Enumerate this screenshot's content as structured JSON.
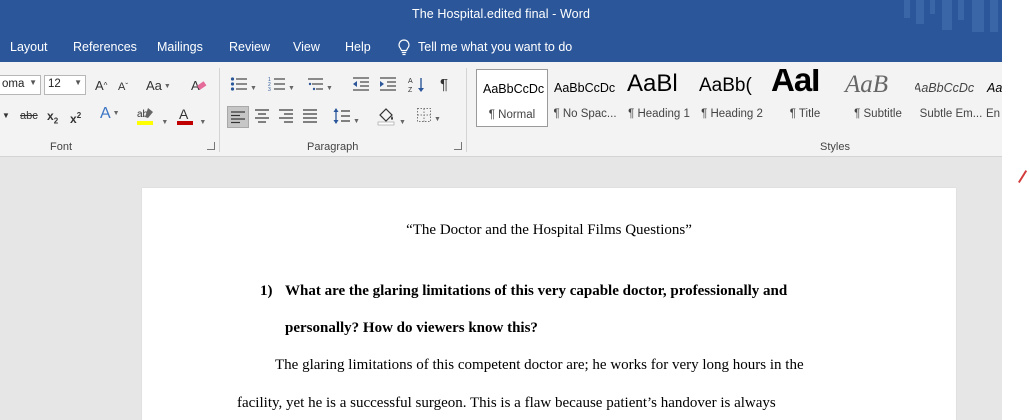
{
  "titlebar": {
    "title": "The Hospital.edited final  -  Word"
  },
  "menu": {
    "items": [
      "Layout",
      "References",
      "Mailings",
      "Review",
      "View",
      "Help"
    ],
    "tell_me": "Tell me what you want to do"
  },
  "font_group": {
    "font_name": "oma",
    "font_size": "12",
    "case_label": "Aa",
    "label": "Font"
  },
  "paragraph_group": {
    "label": "Paragraph"
  },
  "styles_group": {
    "label": "Styles",
    "items": [
      {
        "preview": "AaBbCcDc",
        "name": "¶ Normal"
      },
      {
        "preview": "AaBbCcDc",
        "name": "¶ No Spac..."
      },
      {
        "preview": "AaBl",
        "name": "¶ Heading 1"
      },
      {
        "preview": "AaBb(",
        "name": "¶ Heading 2"
      },
      {
        "preview": "AaI",
        "name": "¶ Title"
      },
      {
        "preview": "AaB",
        "name": "¶ Subtitle"
      },
      {
        "preview": "AaBbCcDc",
        "name": "Subtle Em..."
      },
      {
        "preview": "Aa",
        "name": "En"
      }
    ]
  },
  "document": {
    "title": "“The Doctor and the Hospital Films Questions”",
    "question_number": "1)",
    "question_line1": "What are the glaring limitations of this very capable doctor, professionally and",
    "question_line2": "personally? How do viewers know this?",
    "para_line1": "The glaring limitations of this competent doctor are; he works for very long hours in the",
    "para_line2": "facility, yet he is a successful surgeon. This is a flaw because patient’s handover is always"
  },
  "colors": {
    "title_bar": "#2b579a",
    "ribbon": "#f3f3f3",
    "canvas": "#e6e6e6",
    "font_color": "#c00000",
    "highlight": "#ffff00"
  }
}
